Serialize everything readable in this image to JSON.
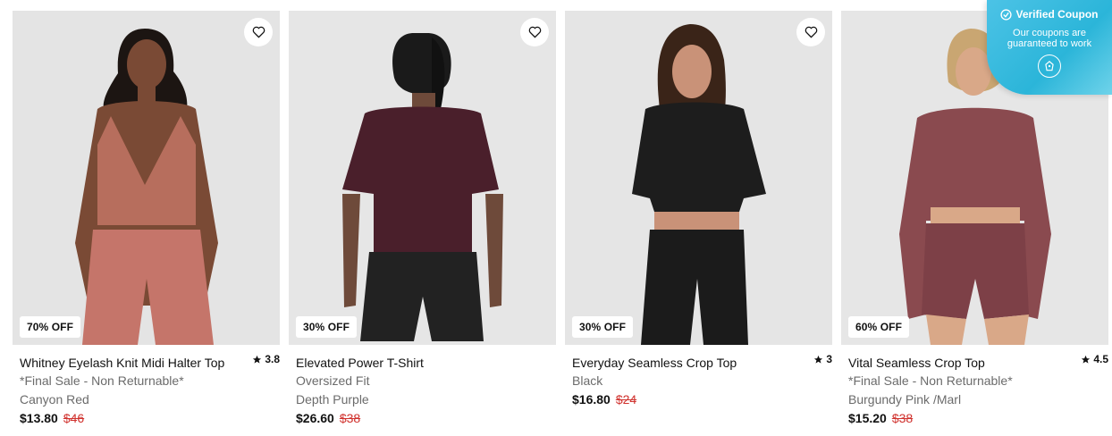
{
  "products": [
    {
      "name": "Whitney Eyelash Knit Midi Halter Top",
      "rating": "3.8",
      "discount": "70% OFF",
      "note": "*Final Sale - Non Returnable*",
      "color": "Canyon Red",
      "price": "$13.80",
      "original_price": "$46"
    },
    {
      "name": "Elevated Power T-Shirt",
      "rating": "",
      "discount": "30% OFF",
      "note": "Oversized Fit",
      "color": "Depth Purple",
      "price": "$26.60",
      "original_price": "$38"
    },
    {
      "name": "Everyday Seamless Crop Top",
      "rating": "3",
      "discount": "30% OFF",
      "note": "",
      "color": "Black",
      "price": "$16.80",
      "original_price": "$24"
    },
    {
      "name": "Vital Seamless Crop Top",
      "rating": "4.5",
      "discount": "60% OFF",
      "note": "*Final Sale - Non Returnable*",
      "color": "Burgundy Pink /Marl",
      "price": "$15.20",
      "original_price": "$38"
    }
  ],
  "coupon_widget": {
    "title": "Verified Coupon",
    "line1": "Our coupons are",
    "line2": "guaranteed to work",
    "icon": "shopping-bag-icon"
  },
  "icons": {
    "wishlist": "heart-icon",
    "rating": "star-icon",
    "verified": "check-circle-icon"
  },
  "colors": {
    "sale_price": "#d0312d",
    "coupon_bg": "#2bb5d9"
  }
}
